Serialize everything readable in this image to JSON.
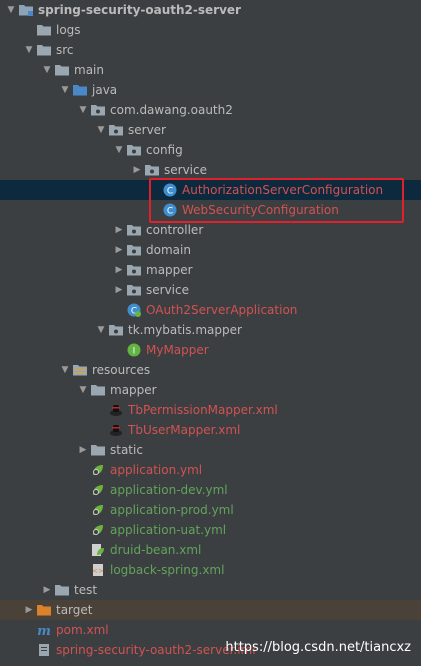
{
  "colors": {
    "background": "#3c3f41",
    "selected_row": "#0d293e",
    "target_row": "#4a4138",
    "error_text": "#d25252",
    "resource_text": "#62a35c",
    "highlight_box": "#e0202a"
  },
  "tree": [
    {
      "label": "spring-security-oauth2-server",
      "depth": 0,
      "arrow": "down",
      "icon": "module-folder-icon",
      "style": "bold"
    },
    {
      "label": "logs",
      "depth": 1,
      "arrow": "none",
      "icon": "folder-icon",
      "style": "normal"
    },
    {
      "label": "src",
      "depth": 1,
      "arrow": "down",
      "icon": "folder-icon",
      "style": "normal"
    },
    {
      "label": "main",
      "depth": 2,
      "arrow": "down",
      "icon": "folder-icon",
      "style": "normal"
    },
    {
      "label": "java",
      "depth": 3,
      "arrow": "down",
      "icon": "source-folder-icon",
      "style": "normal"
    },
    {
      "label": "com.dawang.oauth2",
      "depth": 4,
      "arrow": "down",
      "icon": "package-icon",
      "style": "normal"
    },
    {
      "label": "server",
      "depth": 5,
      "arrow": "down",
      "icon": "package-icon",
      "style": "normal"
    },
    {
      "label": "config",
      "depth": 6,
      "arrow": "down",
      "icon": "package-icon",
      "style": "normal"
    },
    {
      "label": "service",
      "depth": 7,
      "arrow": "right",
      "icon": "package-icon",
      "style": "normal"
    },
    {
      "label": "AuthorizationServerConfiguration",
      "depth": 8,
      "arrow": "none",
      "icon": "class-icon",
      "style": "red",
      "selected": true
    },
    {
      "label": "WebSecurityConfiguration",
      "depth": 8,
      "arrow": "none",
      "icon": "class-icon",
      "style": "red"
    },
    {
      "label": "controller",
      "depth": 6,
      "arrow": "right",
      "icon": "package-icon",
      "style": "normal"
    },
    {
      "label": "domain",
      "depth": 6,
      "arrow": "right",
      "icon": "package-icon",
      "style": "normal"
    },
    {
      "label": "mapper",
      "depth": 6,
      "arrow": "right",
      "icon": "package-icon",
      "style": "normal"
    },
    {
      "label": "service",
      "depth": 6,
      "arrow": "right",
      "icon": "package-icon",
      "style": "normal"
    },
    {
      "label": "OAuth2ServerApplication",
      "depth": 6,
      "arrow": "none",
      "icon": "spring-class-icon",
      "style": "red"
    },
    {
      "label": "tk.mybatis.mapper",
      "depth": 5,
      "arrow": "down",
      "icon": "package-icon",
      "style": "normal"
    },
    {
      "label": "MyMapper",
      "depth": 6,
      "arrow": "none",
      "icon": "interface-icon",
      "style": "red"
    },
    {
      "label": "resources",
      "depth": 3,
      "arrow": "down",
      "icon": "resources-folder-icon",
      "style": "normal"
    },
    {
      "label": "mapper",
      "depth": 4,
      "arrow": "down",
      "icon": "folder-icon",
      "style": "normal"
    },
    {
      "label": "TbPermissionMapper.xml",
      "depth": 5,
      "arrow": "none",
      "icon": "mybatis-xml-icon",
      "style": "red"
    },
    {
      "label": "TbUserMapper.xml",
      "depth": 5,
      "arrow": "none",
      "icon": "mybatis-xml-icon",
      "style": "red"
    },
    {
      "label": "static",
      "depth": 4,
      "arrow": "right",
      "icon": "folder-icon",
      "style": "normal"
    },
    {
      "label": "application.yml",
      "depth": 4,
      "arrow": "none",
      "icon": "spring-yml-icon",
      "style": "red"
    },
    {
      "label": "application-dev.yml",
      "depth": 4,
      "arrow": "none",
      "icon": "spring-yml-icon",
      "style": "green"
    },
    {
      "label": "application-prod.yml",
      "depth": 4,
      "arrow": "none",
      "icon": "spring-yml-icon",
      "style": "green"
    },
    {
      "label": "application-uat.yml",
      "depth": 4,
      "arrow": "none",
      "icon": "spring-yml-icon",
      "style": "green"
    },
    {
      "label": "druid-bean.xml",
      "depth": 4,
      "arrow": "none",
      "icon": "spring-xml-icon",
      "style": "green"
    },
    {
      "label": "logback-spring.xml",
      "depth": 4,
      "arrow": "none",
      "icon": "xml-file-icon",
      "style": "green"
    },
    {
      "label": "test",
      "depth": 2,
      "arrow": "right",
      "icon": "folder-icon",
      "style": "normal"
    },
    {
      "label": "target",
      "depth": 1,
      "arrow": "right",
      "icon": "target-folder-icon",
      "style": "normal",
      "target": true
    },
    {
      "label": "pom.xml",
      "depth": 1,
      "arrow": "none",
      "icon": "maven-icon",
      "style": "red"
    },
    {
      "label": "spring-security-oauth2-server.iml",
      "depth": 1,
      "arrow": "none",
      "icon": "iml-file-icon",
      "style": "red"
    }
  ],
  "watermark": "https://blog.csdn.net/tiancxz"
}
